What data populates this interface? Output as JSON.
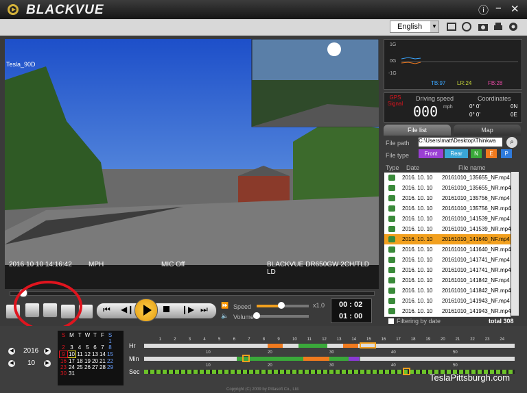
{
  "app": {
    "brand": "BLACKVUE",
    "language": "English",
    "copyright": "Copyright (C) 2009 by Pittasoft Co., Ltd."
  },
  "video": {
    "label": "Tesla_90D",
    "timestamp": "2016 10 10  14:16:42",
    "mph": "MPH",
    "mic": "MIC Off",
    "model": "BLACKVUE DR650GW 2CH/TLD LD"
  },
  "sensor": {
    "g_labels": [
      "1G",
      "0G",
      "-1G"
    ],
    "tb": "TB:97",
    "lr": "LR:24",
    "fb": "FB:28"
  },
  "gps": {
    "signal_label": "GPS\nSignal",
    "driving_speed": "Driving speed",
    "speed_value": "000",
    "unit": "mph",
    "coordinates": "Coordinates",
    "lat": "0°   0'",
    "lat_dir": "0N",
    "lon": "0°   0'",
    "lon_dir": "0E"
  },
  "tabs": {
    "file_list": "File list",
    "map": "Map"
  },
  "file_path": {
    "label": "File path",
    "value": "C:\\Users\\matt\\Desktop\\Thinkwa"
  },
  "file_type": {
    "label": "File type",
    "front": "Front",
    "rear": "Rear",
    "n": "N",
    "e": "E",
    "p": "P"
  },
  "list_header": {
    "type": "Type",
    "date": "Date",
    "name": "File name"
  },
  "files": [
    {
      "date": "2016. 10. 10",
      "name": "20161010_135655_NF.mp4"
    },
    {
      "date": "2016. 10. 10",
      "name": "20161010_135655_NR.mp4"
    },
    {
      "date": "2016. 10. 10",
      "name": "20161010_135756_NF.mp4"
    },
    {
      "date": "2016. 10. 10",
      "name": "20161010_135756_NR.mp4"
    },
    {
      "date": "2016. 10. 10",
      "name": "20161010_141539_NF.mp4"
    },
    {
      "date": "2016. 10. 10",
      "name": "20161010_141539_NR.mp4"
    },
    {
      "date": "2016. 10. 10",
      "name": "20161010_141640_NF.mp4"
    },
    {
      "date": "2016. 10. 10",
      "name": "20161010_141640_NR.mp4"
    },
    {
      "date": "2016. 10. 10",
      "name": "20161010_141741_NF.mp4"
    },
    {
      "date": "2016. 10. 10",
      "name": "20161010_141741_NR.mp4"
    },
    {
      "date": "2016. 10. 10",
      "name": "20161010_141842_NF.mp4"
    },
    {
      "date": "2016. 10. 10",
      "name": "20161010_141842_NR.mp4"
    },
    {
      "date": "2016. 10. 10",
      "name": "20161010_141943_NF.mp4"
    },
    {
      "date": "2016. 10. 10",
      "name": "20161010_141943_NR.mp4"
    }
  ],
  "selected_file_index": 6,
  "filter": {
    "label": "Filtering by date",
    "total": "total  308"
  },
  "playback": {
    "speed_label": "Speed",
    "speed_value": "x1.0",
    "volume_label": "Volume",
    "time_elapsed": "00 : 02",
    "time_total": "01 : 00"
  },
  "calendar": {
    "year": "2016",
    "month": "10",
    "days_header": [
      "S",
      "M",
      "T",
      "W",
      "T",
      "F",
      "S"
    ],
    "weeks": [
      [
        "",
        "",
        "",
        "",
        "",
        "",
        "1"
      ],
      [
        "2",
        "3",
        "4",
        "5",
        "6",
        "7",
        "8"
      ],
      [
        "9",
        "10",
        "11",
        "12",
        "13",
        "14",
        "15"
      ],
      [
        "16",
        "17",
        "18",
        "19",
        "20",
        "21",
        "22"
      ],
      [
        "23",
        "24",
        "25",
        "26",
        "27",
        "28",
        "29"
      ],
      [
        "30",
        "31",
        "",
        "",
        "",
        "",
        ""
      ]
    ]
  },
  "timeline": {
    "hr_label": "Hr",
    "min_label": "Min",
    "sec_label": "Sec",
    "hr_ticks": [
      "1",
      "2",
      "3",
      "4",
      "5",
      "6",
      "7",
      "8",
      "9",
      "10",
      "11",
      "12",
      "13",
      "14",
      "15",
      "16",
      "17",
      "18",
      "19",
      "20",
      "21",
      "22",
      "23",
      "24"
    ],
    "min_ticks": [
      "10",
      "20",
      "30",
      "40",
      "50"
    ],
    "sec_ticks": [
      "10",
      "20",
      "30",
      "40",
      "50"
    ]
  },
  "watermark": "TeslaPittsburgh.com",
  "colors": {
    "accent": "#f2a01e",
    "front": "#9b3fd4",
    "rear": "#3aa6d6",
    "n": "#3aa83a",
    "e": "#f07a1e",
    "p": "#2f7bdc",
    "annotation": "#e0141e"
  }
}
